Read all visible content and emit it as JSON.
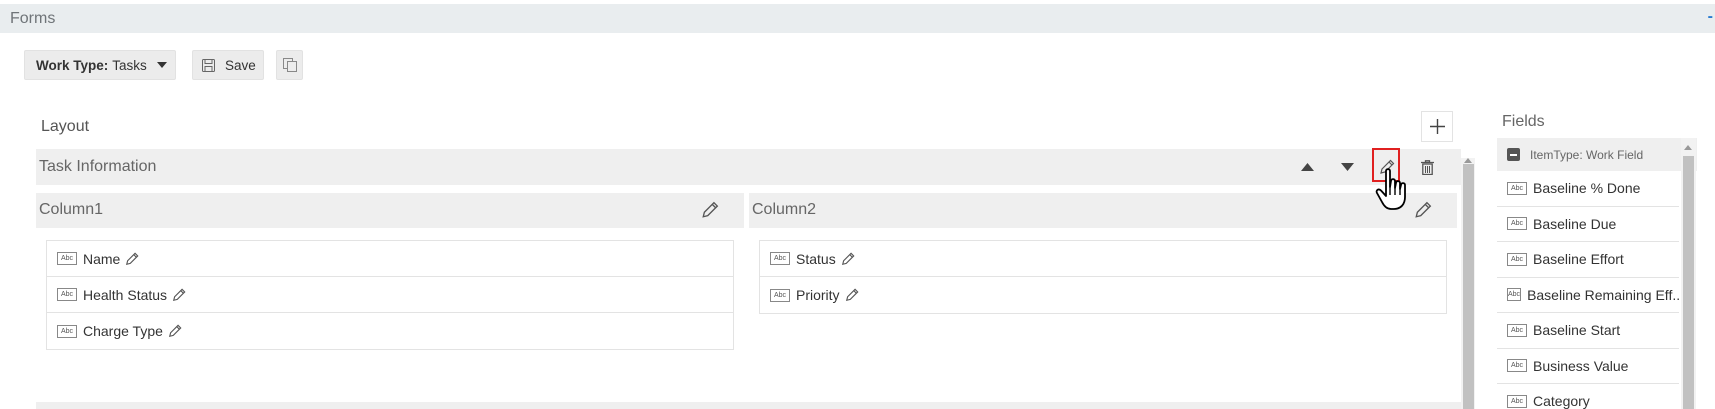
{
  "header": {
    "title": "Forms",
    "collapse_glyph": "-"
  },
  "toolbar": {
    "work_type_label": "Work Type:",
    "work_type_value": "Tasks",
    "save_label": "Save"
  },
  "layout": {
    "label": "Layout",
    "section": {
      "title": "Task Information",
      "columns": [
        {
          "title": "Column1",
          "fields": [
            "Name",
            "Health Status",
            "Charge Type"
          ]
        },
        {
          "title": "Column2",
          "fields": [
            "Status",
            "Priority"
          ]
        }
      ]
    }
  },
  "fields_panel": {
    "title": "Fields",
    "group_label": "ItemType: Work Field",
    "items": [
      "Baseline % Done",
      "Baseline Due",
      "Baseline Effort",
      "Baseline Remaining Eff...",
      "Baseline Start",
      "Business Value",
      "Category"
    ]
  },
  "field_type_badge": "Abc",
  "colors": {
    "highlight": "#e02020",
    "accent": "#2a7bd0",
    "panel_bg": "#efefef"
  },
  "icons": [
    "caret-down-icon",
    "save-icon",
    "copy-icon",
    "plus-icon",
    "move-up-icon",
    "move-down-icon",
    "pencil-icon",
    "trash-icon",
    "hand-cursor-icon",
    "collapse-icon"
  ]
}
